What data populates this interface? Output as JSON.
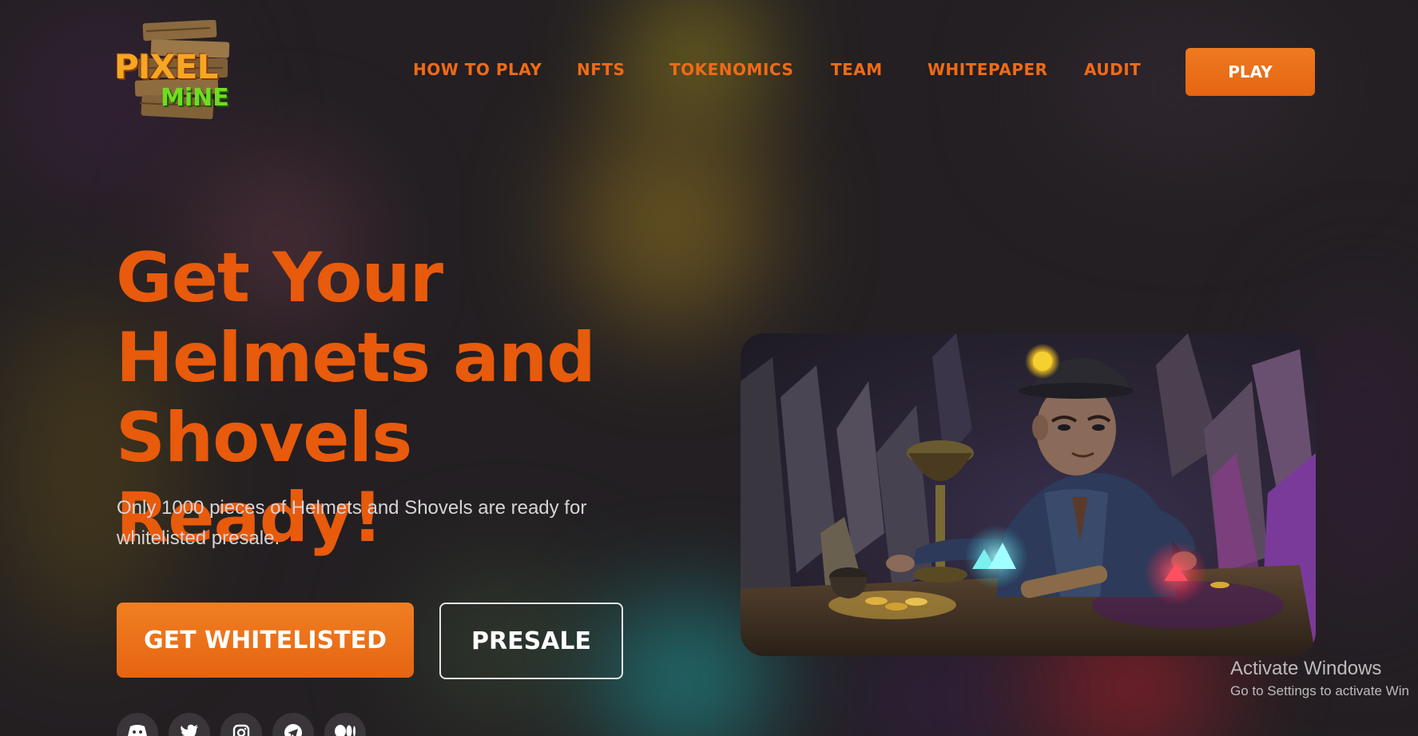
{
  "header": {
    "logo": {
      "line1": "PIXEL",
      "line2": "MiNE"
    },
    "nav": [
      {
        "label": "HOW TO PLAY"
      },
      {
        "label": "NFTS"
      },
      {
        "label": "TOKENOMICS"
      },
      {
        "label": "TEAM"
      },
      {
        "label": "WHITEPAPER"
      },
      {
        "label": "AUDIT"
      }
    ],
    "play_label": "PLAY"
  },
  "hero": {
    "title_lines": [
      "Get Your",
      "Helmets and",
      "Shovels Ready!"
    ],
    "subtitle": "Only 1000 pieces of Helmets and Shovels are ready for whitelisted presale.",
    "primary_button": "GET WHITELISTED",
    "secondary_button": "PRESALE"
  },
  "socials": [
    {
      "icon": "discord-icon"
    },
    {
      "icon": "twitter-icon"
    },
    {
      "icon": "instagram-icon"
    },
    {
      "icon": "telegram-icon"
    },
    {
      "icon": "medium-icon"
    }
  ],
  "watermark": {
    "title": "Activate Windows",
    "subtitle": "Go to Settings to activate Win"
  },
  "colors": {
    "accent": "#e66412",
    "heading": "#e85a0c",
    "nav": "#f06a16",
    "background": "#231f22"
  }
}
